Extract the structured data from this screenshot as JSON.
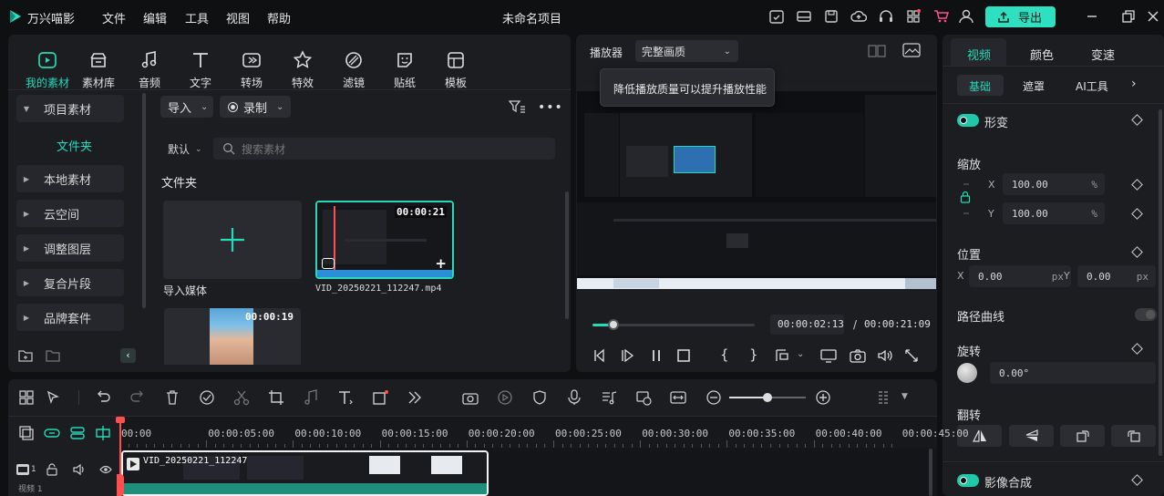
{
  "app": {
    "name": "万兴喵影",
    "project_title": "未命名项目"
  },
  "menu": [
    "文件",
    "编辑",
    "工具",
    "视图",
    "帮助"
  ],
  "export_label": "导出",
  "tool_tabs": [
    {
      "label": "我的素材",
      "icon": "media-icon",
      "active": true
    },
    {
      "label": "素材库",
      "icon": "library-icon"
    },
    {
      "label": "音频",
      "icon": "music-icon"
    },
    {
      "label": "文字",
      "icon": "text-icon"
    },
    {
      "label": "转场",
      "icon": "transition-icon"
    },
    {
      "label": "特效",
      "icon": "effects-icon"
    },
    {
      "label": "滤镜",
      "icon": "filter-icon"
    },
    {
      "label": "贴纸",
      "icon": "sticker-icon"
    },
    {
      "label": "模板",
      "icon": "template-icon"
    }
  ],
  "sidebar": {
    "project_media": "项目素材",
    "folder": "文件夹",
    "items": [
      "本地素材",
      "云空间",
      "调整图层",
      "复合片段",
      "品牌套件"
    ]
  },
  "media": {
    "import_label": "导入",
    "record_label": "录制",
    "sort_label": "默认",
    "search_placeholder": "搜索素材",
    "section_title": "文件夹",
    "import_media_label": "导入媒体",
    "items": [
      {
        "name": "VID_20250221_112247.mp4",
        "duration": "00:00:21"
      },
      {
        "name": "",
        "duration": "00:00:19"
      }
    ]
  },
  "player": {
    "label": "播放器",
    "quality": "完整画质",
    "tooltip": "降低播放质量可以提升播放性能",
    "current_time": "00:00:02:13",
    "separator": "/",
    "total_time": "00:00:21:09",
    "progress": 0.13
  },
  "inspector": {
    "tabs": [
      "视频",
      "颜色",
      "变速"
    ],
    "subtabs": [
      "基础",
      "遮罩",
      "AI工具"
    ],
    "transform_label": "形变",
    "scale_label": "缩放",
    "scale_x": "100.00",
    "scale_y": "100.00",
    "percent_unit": "%",
    "position_label": "位置",
    "pos_x": "0.00",
    "pos_y": "0.00",
    "px_unit": "px",
    "path_curve_label": "路径曲线",
    "rotate_label": "旋转",
    "rotate_value": "0.00°",
    "flip_label": "翻转",
    "composite_label": "影像合成",
    "x_label": "X",
    "y_label": "Y"
  },
  "timeline": {
    "ruler": [
      "00:00",
      "00:00:05:00",
      "00:00:10:00",
      "00:00:15:00",
      "00:00:20:00",
      "00:00:25:00",
      "00:00:30:00",
      "00:00:35:00",
      "00:00:40:00",
      "00:00:45:00"
    ],
    "clip_name": "VID_20250221_112247",
    "track_label": "视频 1",
    "track_number": "1"
  },
  "colors": {
    "accent": "#26d9b8",
    "export_bg": "#2fe0c0",
    "playhead": "#ff4f4f"
  }
}
